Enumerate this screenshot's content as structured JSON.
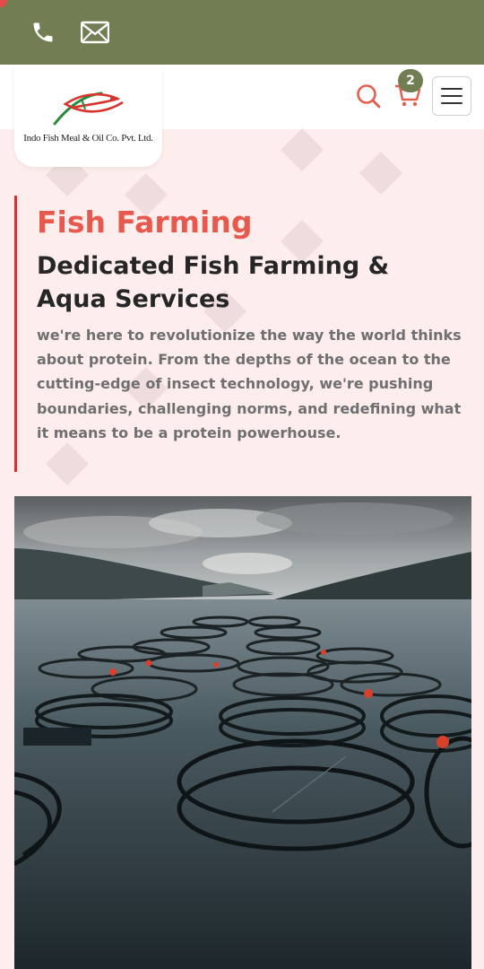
{
  "contact_bar": {
    "icons": [
      "phone-icon",
      "mail-icon"
    ],
    "color": "#717d52"
  },
  "header": {
    "logo_text": "Indo Fish Meal & Oil Co. Pvt. Ltd.",
    "search_icon": "search-icon",
    "cart": {
      "icon": "cart-icon",
      "count": "2"
    },
    "menu_icon": "hamburger-menu-icon"
  },
  "hero": {
    "eyebrow": "Fish Farming",
    "heading": "Dedicated Fish Farming & Aqua Services",
    "body": "we're here to revolutionize the way the world thinks about protein. From the depths of the ocean to the cutting-edge of insect technology, we're pushing boundaries, challenging norms, and redefining what it means to be a protein powerhouse."
  },
  "colors": {
    "accent": "#e7594c",
    "brand_green": "#717d52",
    "background": "#fdeeed",
    "border_red": "#d9302d"
  }
}
